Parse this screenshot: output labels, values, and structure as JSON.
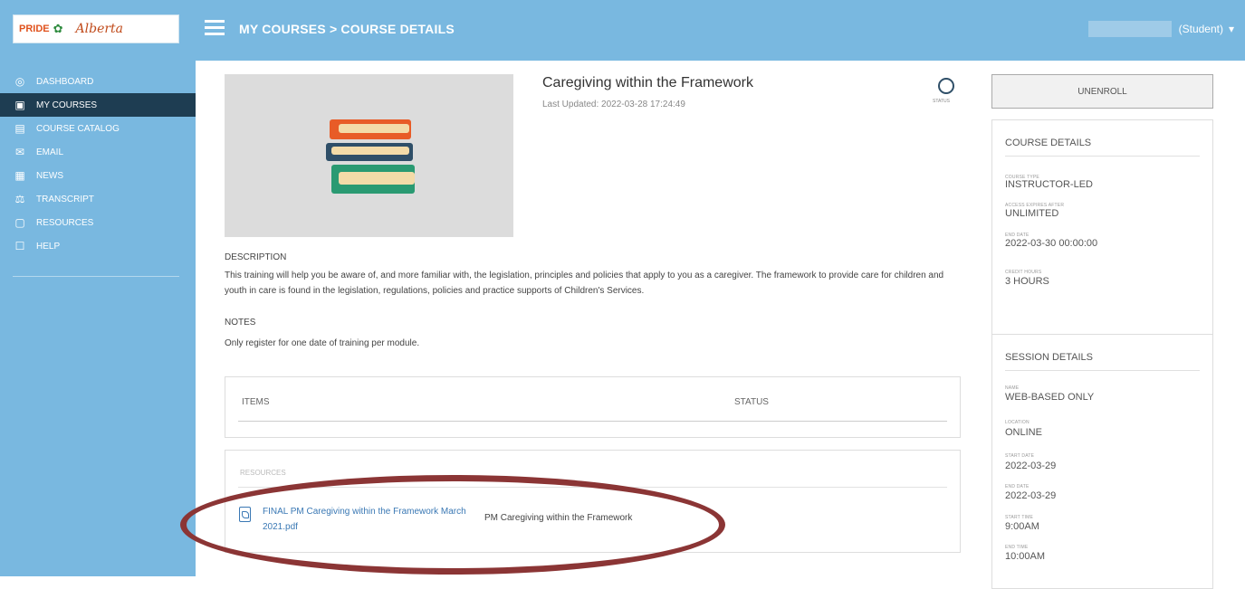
{
  "header": {
    "logo": {
      "part1": "PRIDE",
      "part2": "Alberta",
      "part3": "Alberta"
    },
    "breadcrumb": "MY COURSES > COURSE DETAILS",
    "user_role": "(Student)",
    "user_caret": "▾"
  },
  "sidebar": {
    "items": [
      {
        "label": "DASHBOARD",
        "icon": "dashboard-icon",
        "glyph": "◎"
      },
      {
        "label": "MY COURSES",
        "icon": "course-book-icon",
        "glyph": "▣"
      },
      {
        "label": "COURSE CATALOG",
        "icon": "catalog-icon",
        "glyph": "▤"
      },
      {
        "label": "EMAIL",
        "icon": "email-icon",
        "glyph": "✉"
      },
      {
        "label": "NEWS",
        "icon": "news-icon",
        "glyph": "▦"
      },
      {
        "label": "TRANSCRIPT",
        "icon": "transcript-chart-icon",
        "glyph": "⚖"
      },
      {
        "label": "RESOURCES",
        "icon": "resources-icon",
        "glyph": "▢"
      },
      {
        "label": "HELP",
        "icon": "help-icon",
        "glyph": "☐"
      }
    ],
    "active_index": 1
  },
  "course": {
    "title": "Caregiving within the Framework",
    "last_updated": "Last Updated: 2022-03-28 17:24:49",
    "status_caption": "STATUS",
    "description_label": "DESCRIPTION",
    "description": "This training will help you be aware of, and more familiar with, the legislation, principles and policies that apply to you as a caregiver. The framework to provide care for children and youth in care is found in the legislation, regulations, policies and practice supports of Children's Services.",
    "notes_label": "NOTES",
    "notes": "Only register for one date of training per module.",
    "items_header": "ITEMS",
    "items_status_header": "STATUS",
    "resources_header": "RESOURCES",
    "resource": {
      "file_name": "FINAL PM Caregiving within the Framework March 2021.pdf",
      "description": "PM Caregiving within the Framework"
    }
  },
  "right_panel": {
    "unenroll_label": "UNENROLL",
    "course_details": {
      "title": "COURSE DETAILS",
      "fields": [
        {
          "label": "COURSE TYPE",
          "value": "INSTRUCTOR-LED"
        },
        {
          "label": "ACCESS EXPIRES AFTER",
          "value": "UNLIMITED"
        },
        {
          "label": "END DATE",
          "value": "2022-03-30 00:00:00"
        },
        {
          "label": "CREDIT HOURS",
          "value": "3 HOURS"
        }
      ]
    },
    "session_details": {
      "title": "SESSION DETAILS",
      "fields": [
        {
          "label": "NAME",
          "value": "WEB-BASED ONLY"
        },
        {
          "label": "LOCATION",
          "value": "ONLINE"
        },
        {
          "label": "START DATE",
          "value": "2022-03-29"
        },
        {
          "label": "END DATE",
          "value": "2022-03-29"
        },
        {
          "label": "START TIME",
          "value": "9:00AM"
        },
        {
          "label": "END TIME",
          "value": "10:00AM"
        }
      ]
    }
  },
  "colors": {
    "header_bg": "#79b8e0",
    "sidebar_active": "#1e3d52",
    "link": "#3a78b4",
    "highlight_ellipse": "#8b3535"
  }
}
